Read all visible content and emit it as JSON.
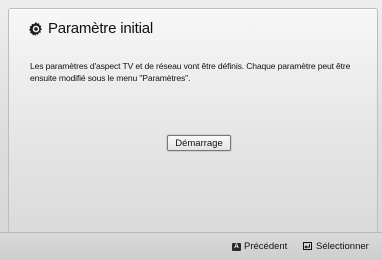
{
  "dialog": {
    "title": "Paramètre initial",
    "message": "Les paramètres d'aspect TV et de réseau vont être définis. Chaque paramètre peut être ensuite modifié sous le menu \"Paramètres\".",
    "start_button": "Démarrage"
  },
  "footer": {
    "back_key": "A",
    "back_label": "Précédent",
    "select_label": "Sélectionner"
  },
  "icons": {
    "title": "gear-icon",
    "back": "a-button-icon",
    "select": "enter-icon"
  }
}
